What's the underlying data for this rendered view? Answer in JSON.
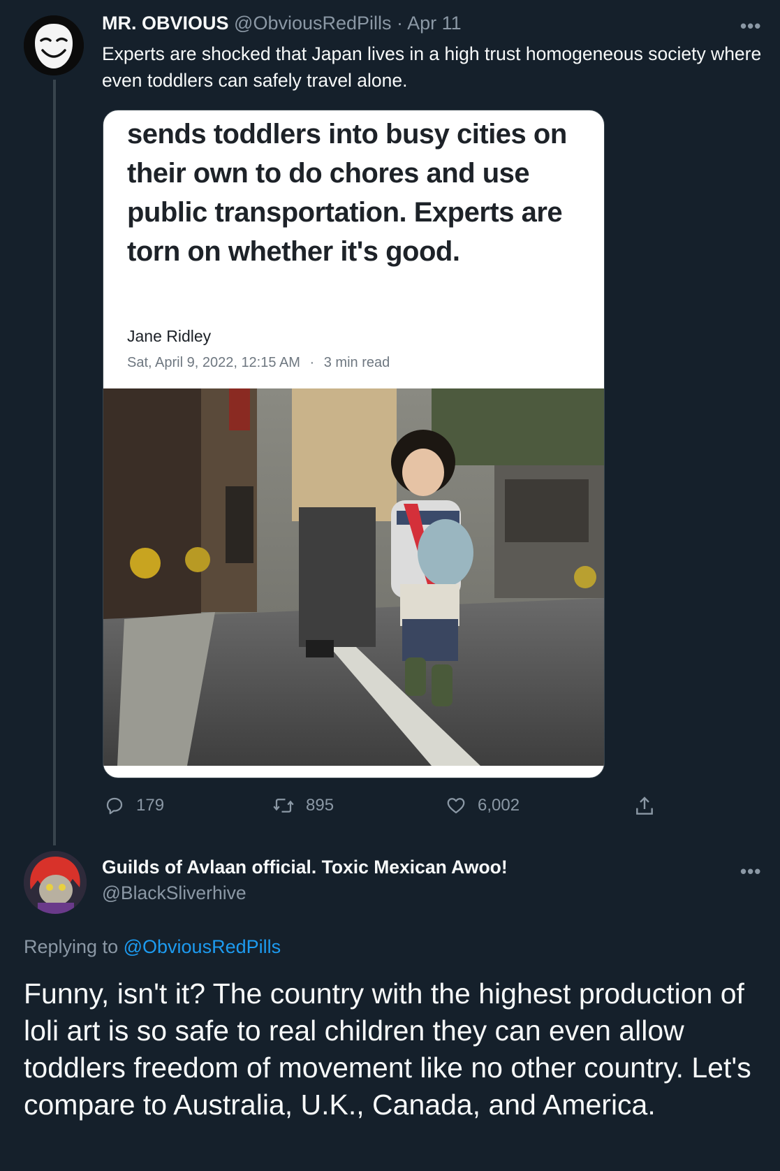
{
  "tweet1": {
    "display_name": "MR. OBVIOUS",
    "handle": "@ObviousRedPills",
    "separator": "·",
    "date": "Apr 11",
    "more": "•••",
    "text": "Experts are shocked that Japan lives in a high trust homogeneous society where even toddlers can safely travel alone.",
    "card": {
      "headline": "sends toddlers into busy cities on their own to do chores and use public transportation. Experts are torn on whether it's good.",
      "author": "Jane Ridley",
      "date": "Sat, April 9, 2022, 12:15 AM",
      "dot": "·",
      "read_time": "3 min read"
    },
    "actions": {
      "replies": "179",
      "retweets": "895",
      "likes": "6,002"
    }
  },
  "tweet2": {
    "display_name": "Guilds of Avlaan official. Toxic Mexican Awoo!",
    "handle": "@BlackSliverhive",
    "more": "•••",
    "replying_prefix": "Replying to",
    "replying_handle": "@ObviousRedPills",
    "text": "Funny, isn't it? The country with the highest production of loli art is so safe to real children they can even allow toddlers freedom of movement like no other country. Let's compare to Australia, U.K., Canada, and America."
  },
  "colors": {
    "background": "#15202b",
    "text": "#f7f9f9",
    "muted": "#8b98a5",
    "link": "#1d9bf0",
    "divider": "#38444d"
  },
  "icons": [
    "mask-avatar",
    "reply-icon",
    "retweet-icon",
    "like-icon",
    "share-icon",
    "anime-avatar",
    "more-icon"
  ]
}
